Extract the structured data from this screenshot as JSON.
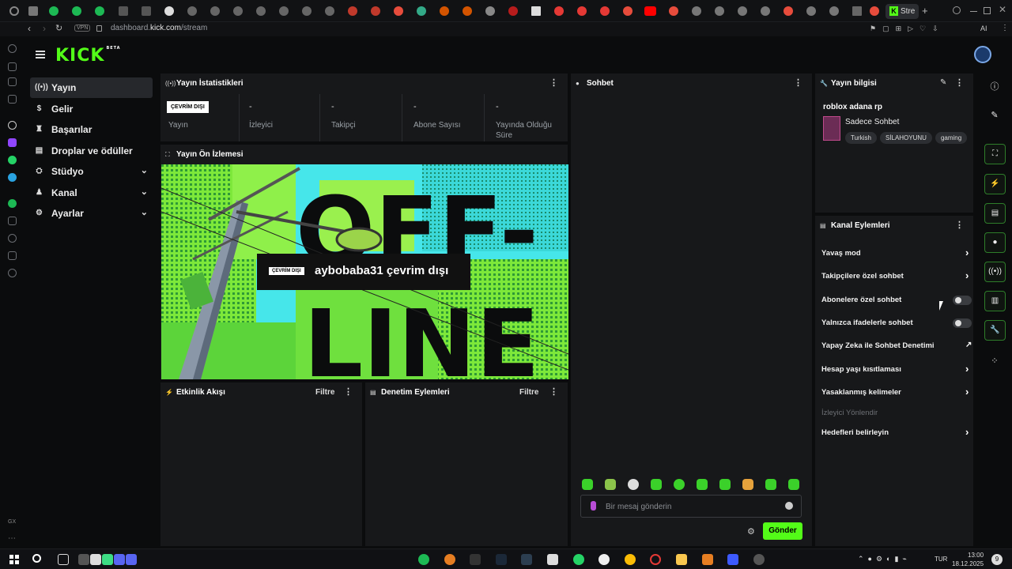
{
  "browser": {
    "active_tab_label": "Stre",
    "vpn_label": "VPN",
    "url_host": "dashboard.",
    "url_domain": "kick.com",
    "url_path": "/stream"
  },
  "header": {
    "logo": "KICK",
    "logo_badge": "BETA"
  },
  "nav": {
    "items": [
      {
        "label": "Yayın",
        "icon": "broadcast-icon"
      },
      {
        "label": "Gelir",
        "icon": "dollar-icon"
      },
      {
        "label": "Başarılar",
        "icon": "trophy-icon"
      },
      {
        "label": "Droplar ve ödüller",
        "icon": "gift-icon"
      },
      {
        "label": "Stüdyo",
        "icon": "studio-icon"
      },
      {
        "label": "Kanal",
        "icon": "person-icon"
      },
      {
        "label": "Ayarlar",
        "icon": "gear-icon"
      }
    ]
  },
  "stats": {
    "title": "Yayın İstatistikleri",
    "status_badge": "ÇEVRİM DIŞI",
    "items": [
      {
        "value": "",
        "label": "Yayın"
      },
      {
        "value": "-",
        "label": "İzleyici"
      },
      {
        "value": "-",
        "label": "Takipçi"
      },
      {
        "value": "-",
        "label": "Abone Sayısı"
      },
      {
        "value": "-",
        "label": "Yayında Olduğu Süre"
      }
    ]
  },
  "preview": {
    "title": "Yayın Ön İzlemesi",
    "badge": "ÇEVRİM DIŞI",
    "message": "aybobaba31 çevrim dışı",
    "art_text_1": "OFF-",
    "art_text_2": "LINE"
  },
  "activity": {
    "title": "Etkinlik Akışı",
    "filter": "Filtre"
  },
  "moderation": {
    "title": "Denetim Eylemleri",
    "filter": "Filtre"
  },
  "chat": {
    "title": "Sohbet",
    "placeholder": "Bir mesaj gönderin",
    "send": "Gönder"
  },
  "stream_info": {
    "title": "Yayın bilgisi",
    "stream_title": "roblox adana rp",
    "category": "Sadece Sohbet",
    "tags": [
      "Turkish",
      "SİLAHOYUNU",
      "gaming"
    ]
  },
  "channel_actions": {
    "title": "Kanal Eylemleri",
    "items": [
      {
        "label": "Yavaş mod",
        "control": "arrow"
      },
      {
        "label": "Takipçilere özel sohbet",
        "control": "arrow"
      },
      {
        "label": "Abonelere özel sohbet",
        "control": "toggle",
        "on": false
      },
      {
        "label": "Yalnızca ifadelerle sohbet",
        "control": "toggle",
        "on": false
      },
      {
        "label": "Yapay Zeka ile Sohbet Denetimi",
        "control": "external"
      },
      {
        "label": "Hesap yaşı kısıtlaması",
        "control": "arrow"
      },
      {
        "label": "Yasaklanmış kelimeler",
        "control": "arrow"
      },
      {
        "label": "İzleyici Yönlendir",
        "control": "none",
        "disabled": true
      },
      {
        "label": "Hedefleri belirleyin",
        "control": "arrow"
      }
    ]
  },
  "taskbar": {
    "lang": "TUR",
    "time": "13:00",
    "date": "18.12.2025",
    "notif_count": "9"
  },
  "colors": {
    "brand_green": "#53fc18",
    "panel_bg": "#17181a",
    "page_bg": "#0b0c0d"
  }
}
